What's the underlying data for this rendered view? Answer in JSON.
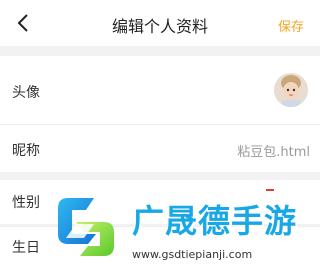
{
  "header": {
    "title": "编辑个人资料",
    "save_label": "保存",
    "accent_color": "#f5a623"
  },
  "rows": [
    {
      "label": "头像"
    },
    {
      "label": "昵称",
      "value": "粘豆包.html"
    },
    {
      "label": "性别"
    },
    {
      "label": "生日"
    }
  ],
  "watermark": {
    "title": "广晟德手游",
    "url": "www.gsdtiepianji.com",
    "color": "#19a8e6"
  }
}
